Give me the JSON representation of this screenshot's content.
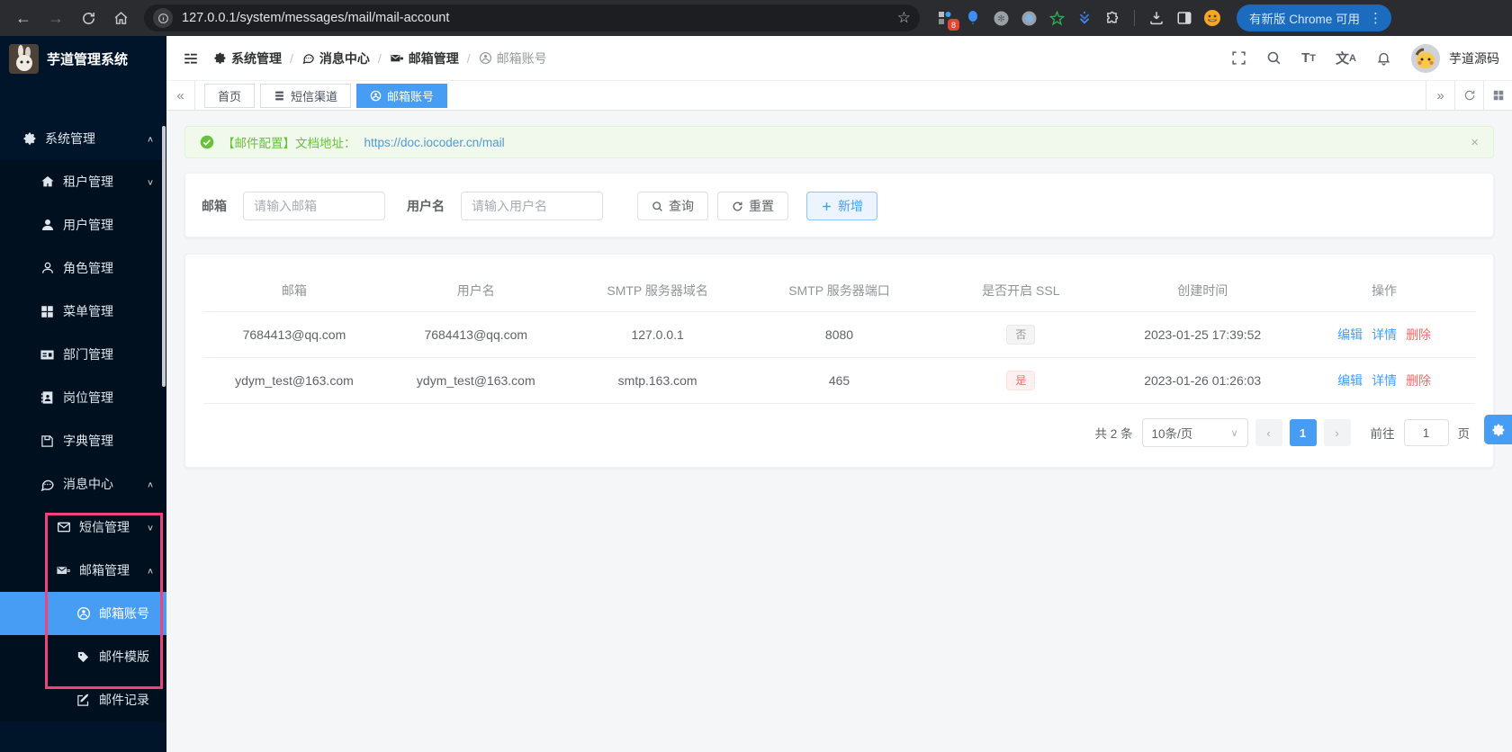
{
  "colors": {
    "primary": "#409eff",
    "danger": "#f56c6c",
    "success": "#67c23a",
    "sidebar_bg": "#001529",
    "annotation": "#f0437b",
    "active_tab": "#469df3"
  },
  "browser": {
    "url": "127.0.0.1/system/messages/mail/mail-account",
    "update_pill": "有新版 Chrome 可用",
    "extension_badge": "8"
  },
  "app": {
    "title": "芋道管理系统",
    "username": "芋道源码"
  },
  "sidebar": {
    "items": [
      {
        "label": "系统管理",
        "icon": "gear-icon",
        "arrow": "∧"
      },
      {
        "label": "租户管理",
        "icon": "home-icon",
        "arrow": "∨"
      },
      {
        "label": "用户管理",
        "icon": "user-filled-icon"
      },
      {
        "label": "角色管理",
        "icon": "user-outline-icon"
      },
      {
        "label": "菜单管理",
        "icon": "grid-icon"
      },
      {
        "label": "部门管理",
        "icon": "id-card-icon"
      },
      {
        "label": "岗位管理",
        "icon": "contact-book-icon"
      },
      {
        "label": "字典管理",
        "icon": "dictionary-icon"
      },
      {
        "label": "消息中心",
        "icon": "chat-icon",
        "arrow": "∧"
      },
      {
        "label": "短信管理",
        "icon": "envelope-icon",
        "arrow": "∨"
      },
      {
        "label": "邮箱管理",
        "icon": "mail-send-icon",
        "arrow": "∧"
      },
      {
        "label": "邮箱账号",
        "icon": "circle-user-icon",
        "active": true
      },
      {
        "label": "邮件模版",
        "icon": "tag-icon"
      },
      {
        "label": "邮件记录",
        "icon": "edit-doc-icon"
      }
    ]
  },
  "breadcrumb": [
    {
      "label": "系统管理"
    },
    {
      "label": "消息中心"
    },
    {
      "label": "邮箱管理"
    },
    {
      "label": "邮箱账号"
    }
  ],
  "tabs": [
    {
      "label": "首页"
    },
    {
      "label": "短信渠道"
    },
    {
      "label": "邮箱账号",
      "active": true
    }
  ],
  "alert": {
    "text": "【邮件配置】文档地址：",
    "link": "https://doc.iocoder.cn/mail",
    "close": "×"
  },
  "search": {
    "email_label": "邮箱",
    "email_placeholder": "请输入邮箱",
    "username_label": "用户名",
    "username_placeholder": "请输入用户名",
    "query": "查询",
    "reset": "重置",
    "add": "新增"
  },
  "table": {
    "columns": [
      "邮箱",
      "用户名",
      "SMTP 服务器域名",
      "SMTP 服务器端口",
      "是否开启 SSL",
      "创建时间",
      "操作"
    ],
    "rows": [
      {
        "email": "7684413@qq.com",
        "username": "7684413@qq.com",
        "host": "127.0.0.1",
        "port": "8080",
        "ssl": "否",
        "created": "2023-01-25 17:39:52"
      },
      {
        "email": "ydym_test@163.com",
        "username": "ydym_test@163.com",
        "host": "smtp.163.com",
        "port": "465",
        "ssl": "是",
        "created": "2023-01-26 01:26:03"
      }
    ],
    "actions": {
      "edit": "编辑",
      "detail": "详情",
      "delete": "删除"
    }
  },
  "pagination": {
    "total": "共 2 条",
    "page_size": "10条/页",
    "prev": "‹",
    "page": "1",
    "next": "›",
    "goto_label": "前往",
    "goto_value": "1",
    "page_suffix": "页"
  }
}
